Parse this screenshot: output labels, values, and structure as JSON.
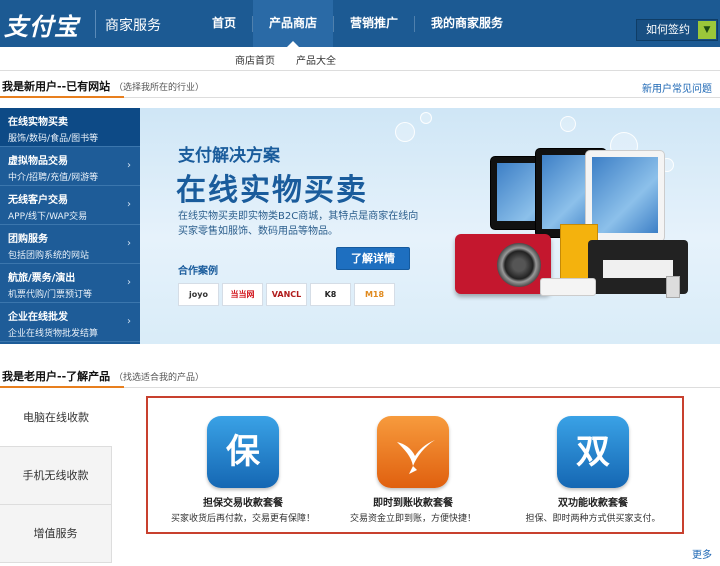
{
  "header": {
    "logo": "支付宝",
    "merchant_label": "商家服务",
    "nav": [
      "首页",
      "产品商店",
      "营销推广",
      "我的商家服务"
    ],
    "active_nav": "产品商店",
    "sign_label": "如何签约",
    "sign_icon": "chevron-down-icon",
    "color": "#1c5a93"
  },
  "subnav": [
    "商店首页",
    "产品大全"
  ],
  "new_user": {
    "title": "我是新用户--已有网站",
    "subtitle": "（选择我所在的行业）",
    "faq_link": "新用户常见问题",
    "accent_color": "#e87f1e"
  },
  "industries": [
    {
      "title": "在线实物买卖",
      "sub": "服饰/数码/食品/图书等"
    },
    {
      "title": "虚拟物品交易",
      "sub": "中介/招聘/充值/网游等"
    },
    {
      "title": "无线客户交易",
      "sub": "APP/线下/WAP交易"
    },
    {
      "title": "团购服务",
      "sub": "包括团购系统的网站"
    },
    {
      "title": "航旅/票务/演出",
      "sub": "机票代购/门票预订等"
    },
    {
      "title": "企业在线批发",
      "sub": "企业在线货物批发结算"
    }
  ],
  "banner": {
    "small_title": "支付解决方案",
    "big_title": "在线实物买卖",
    "desc": "在线实物买卖即实物类B2C商城，其特点是商家在线向买家零售如服饰、数码用品等物品。",
    "button": "了解详情",
    "cases_label": "合作案例",
    "cases": [
      "joyo amazon",
      "当当网",
      "VANCL",
      "K8",
      "M18"
    ]
  },
  "old_user": {
    "title": "我是老用户--了解产品",
    "subtitle": "（找选适合我的产品）",
    "tabs": [
      "电脑在线收款",
      "手机无线收款",
      "增值服务"
    ],
    "products": [
      {
        "icon_char": "保",
        "icon": "shield-icon",
        "name": "担保交易收款套餐",
        "desc": "买家收货后再付款，交易更有保障！",
        "color": "#1f7fc9"
      },
      {
        "icon_char": "",
        "icon": "swallow-icon",
        "name": "即时到账收款套餐",
        "desc": "交易资金立即到账，方便快捷！",
        "color": "#ef7d1b"
      },
      {
        "icon_char": "双",
        "icon": "double-icon",
        "name": "双功能收款套餐",
        "desc": "担保、即时两种方式供买家支付。",
        "color": "#1f7fc9"
      }
    ],
    "more": "更多",
    "highlight_color": "#c8402e"
  }
}
